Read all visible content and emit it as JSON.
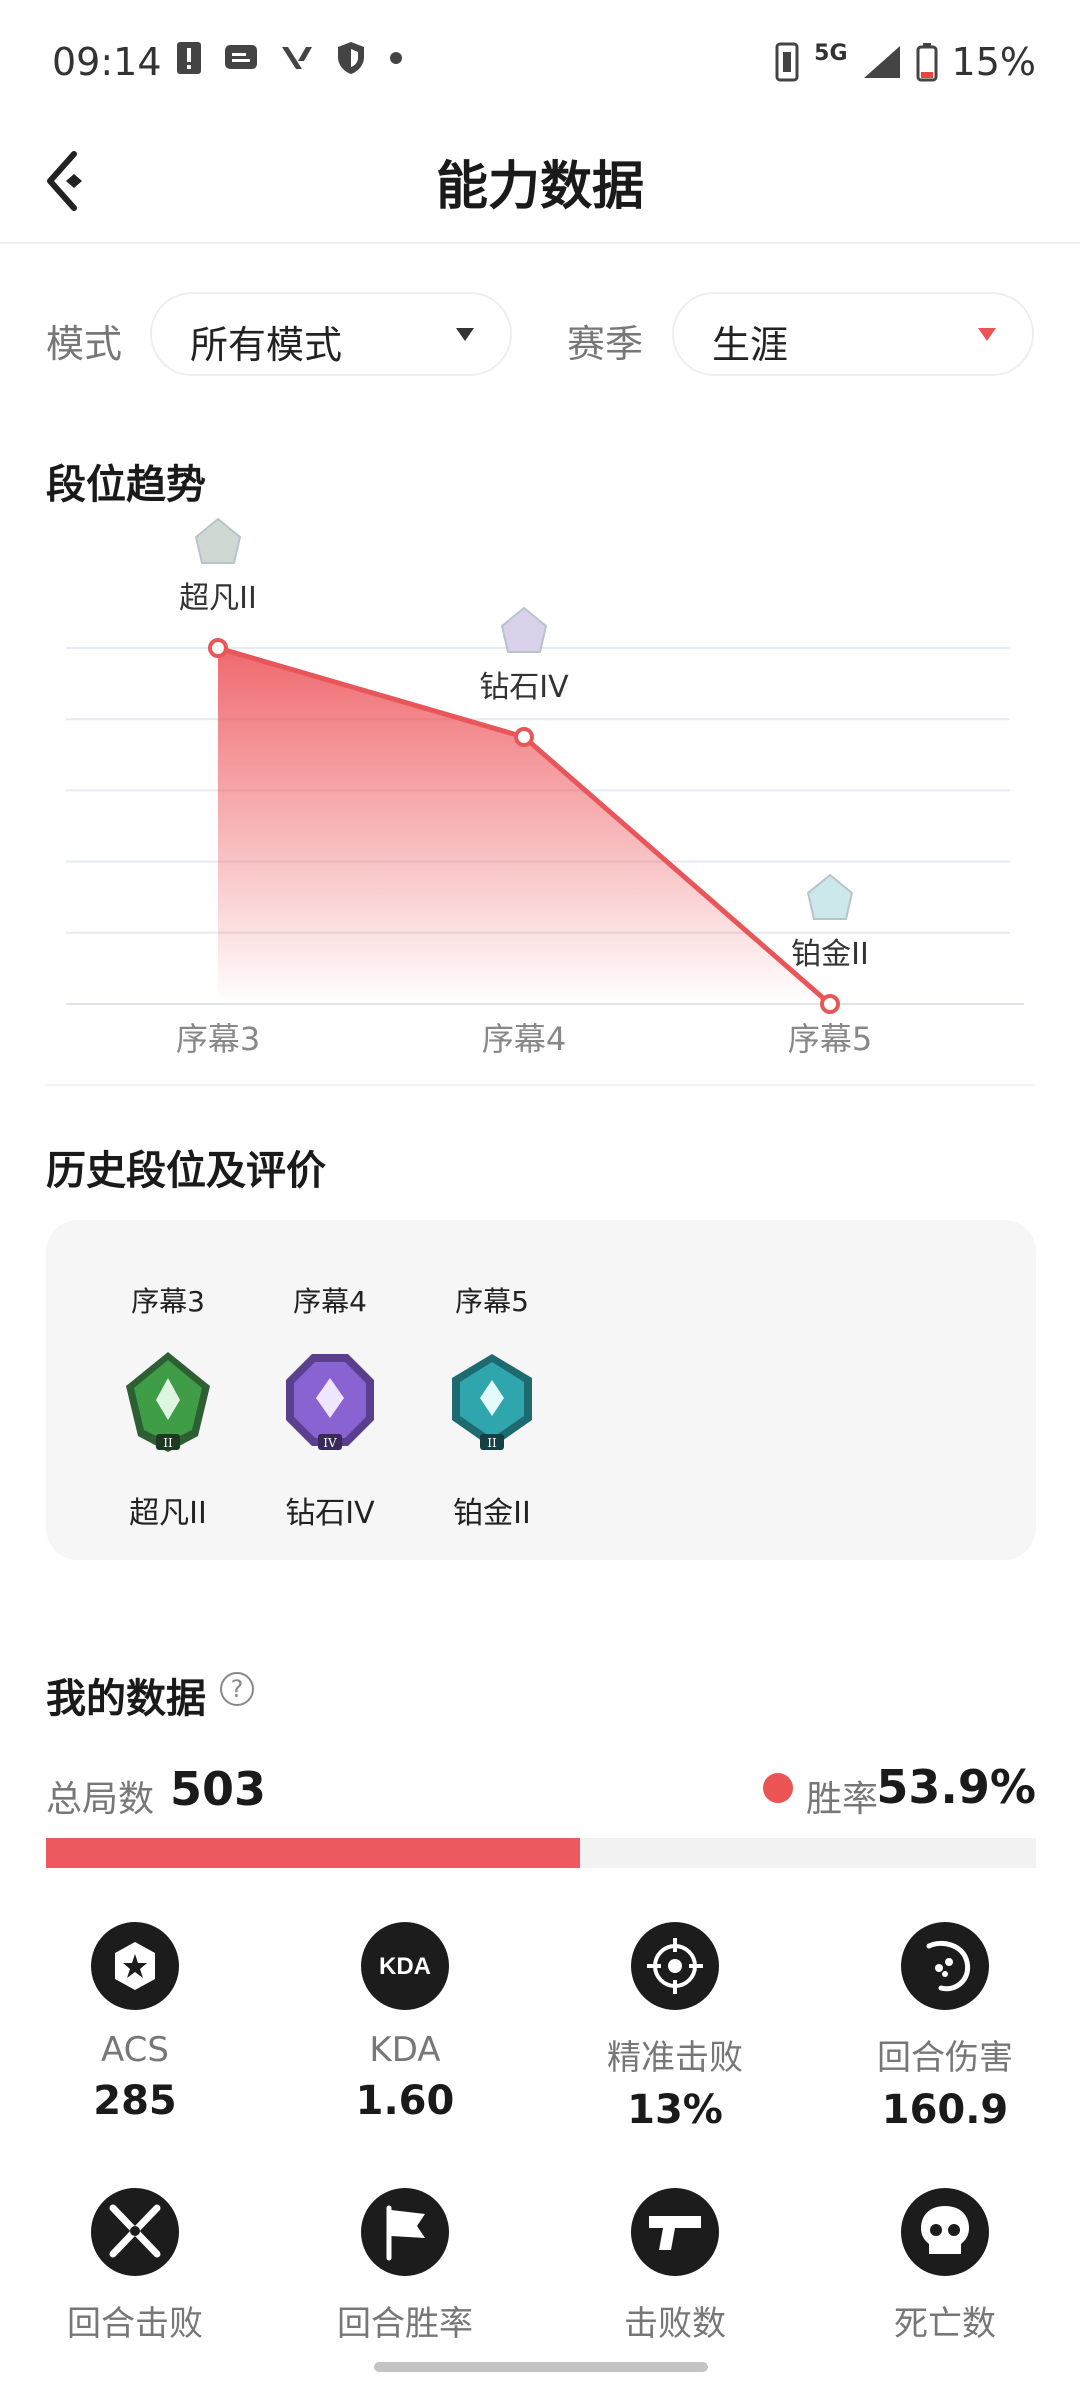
{
  "status_bar": {
    "time": "09:14",
    "network": "5G",
    "battery": "15%",
    "icons": [
      "alert-icon",
      "message-icon",
      "valorant-icon",
      "shield-icon",
      "dot-icon"
    ]
  },
  "header": {
    "title": "能力数据",
    "back_icon": "back-arrow-icon"
  },
  "filters": {
    "mode_label": "模式",
    "mode_value": "所有模式",
    "season_label": "赛季",
    "season_value": "生涯",
    "mode_arrow_color": "#333333",
    "season_arrow_color": "#ec5454"
  },
  "trend": {
    "title": "段位趋势"
  },
  "chart_data": {
    "type": "area",
    "categories": [
      "序幕3",
      "序幕4",
      "序幕5"
    ],
    "rank_labels": [
      "超凡II",
      "钻石IV",
      "铂金II"
    ],
    "rank_levels": [
      5,
      3.75,
      0
    ],
    "ylim": [
      0,
      5
    ],
    "grid": true,
    "line_color": "#e9565a"
  },
  "history": {
    "title": "历史段位及评价",
    "items": [
      {
        "season": "序幕3",
        "rank": "超凡II",
        "badge_color": "#3f9c47",
        "tier": "II"
      },
      {
        "season": "序幕4",
        "rank": "钻石IV",
        "badge_color": "#8a63d2",
        "tier": "IV"
      },
      {
        "season": "序幕5",
        "rank": "铂金II",
        "badge_color": "#2fa6ad",
        "tier": "II"
      }
    ]
  },
  "my_data": {
    "title": "我的数据",
    "help_icon": "?",
    "total_label": "总局数",
    "total_value": "503",
    "win_label": "胜率",
    "win_value": "53.9%",
    "win_fraction": 0.539,
    "win_color": "#ec5454"
  },
  "stats_row1": [
    {
      "icon": "acs-star-icon",
      "label": "ACS",
      "value": "285"
    },
    {
      "icon": "kda-icon",
      "label": "KDA",
      "value": "1.60",
      "icon_text": "KDA"
    },
    {
      "icon": "crosshair-icon",
      "label": "精准击败",
      "value": "13%"
    },
    {
      "icon": "damage-icon",
      "label": "回合伤害",
      "value": "160.9"
    }
  ],
  "stats_row2": [
    {
      "icon": "crossed-blades-icon",
      "label": "回合击败"
    },
    {
      "icon": "flag-icon",
      "label": "回合胜率"
    },
    {
      "icon": "pistol-icon",
      "label": "击败数"
    },
    {
      "icon": "skull-icon",
      "label": "死亡数"
    }
  ]
}
